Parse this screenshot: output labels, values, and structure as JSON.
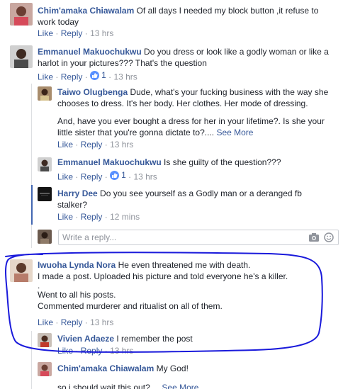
{
  "comments": [
    {
      "author": "Chim'amaka Chiawalam",
      "text": "Of all days I needed my block button ,it refuse to work today",
      "actions": {
        "like": "Like",
        "reply": "Reply",
        "time": "13 hrs"
      }
    },
    {
      "author": "Emmanuel Makuochukwu",
      "text": "Do you dress or look like a godly woman or like a harlot in your pictures??? That's the question",
      "actions": {
        "like": "Like",
        "reply": "Reply",
        "reaction_count": "1",
        "time": "13 hrs"
      },
      "replies": [
        {
          "author": "Taiwo Olugbenga",
          "text": "Dude, what's your fucking business with the way she chooses to dress. It's her body. Her clothes. Her mode of dressing.",
          "text2": "And, have you ever bought a dress for her in your lifetime?. Is she your little sister that you're gonna dictate to?....",
          "see_more": "See More",
          "actions": {
            "like": "Like",
            "reply": "Reply",
            "time": "13 hrs"
          }
        },
        {
          "author": "Emmanuel Makuochukwu",
          "text": "Is she guilty of the question???",
          "actions": {
            "like": "Like",
            "reply": "Reply",
            "reaction_count": "1",
            "time": "13 hrs"
          }
        },
        {
          "author": "Harry Dee",
          "text": "Do you see yourself as a Godly man or a deranged fb stalker?",
          "actions": {
            "like": "Like",
            "reply": "Reply",
            "time": "12 mins"
          }
        }
      ],
      "reply_box": {
        "placeholder": "Write a reply..."
      }
    },
    {
      "author": "Iwuoha Lynda Nora",
      "lines": [
        "He even threatened me with death.",
        "I made a post. Uploaded his picture and told everyone he's a killer.",
        ".",
        "Went to all his posts.",
        "Commented murderer and ritualist on all of them."
      ],
      "actions": {
        "like": "Like",
        "reply": "Reply",
        "time": "13 hrs"
      },
      "replies": [
        {
          "author": "Vivien Adaeze",
          "text": "I remember the post",
          "actions": {
            "like": "Like",
            "reply": "Reply",
            "time": "13 hrs"
          }
        },
        {
          "author": "Chim'amaka Chiawalam",
          "text": "My God!",
          "text2": "so i should wait this out?....",
          "see_more": "See More"
        }
      ]
    }
  ],
  "separator": "·",
  "colors": {
    "link": "#365899",
    "meta": "#90949c",
    "annotation": "#1a1adb",
    "like": "#5890ff"
  }
}
